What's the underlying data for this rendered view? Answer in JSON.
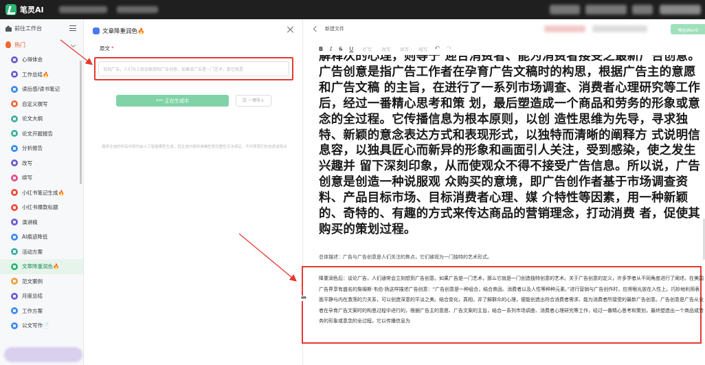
{
  "app": {
    "name": "笔灵AI",
    "brand_color": "#2bb673"
  },
  "sidebar": {
    "back_label": "前往工作台",
    "group_label": "热门",
    "items": [
      {
        "label": "心得体会",
        "color": "#6b5bd6"
      },
      {
        "label": "工作总结🔥",
        "color": "#6b5bd6"
      },
      {
        "label": "读后感/读书笔记",
        "color": "#3b8bf0"
      },
      {
        "label": "自定义撰写",
        "color": "#f06b3b"
      },
      {
        "label": "论文大纲",
        "color": "#3bb0a0"
      },
      {
        "label": "论文开题报告",
        "color": "#3bb0a0"
      },
      {
        "label": "分析报告",
        "color": "#3b8bf0"
      },
      {
        "label": "改写",
        "color": "#6b5bd6"
      },
      {
        "label": "续写",
        "color": "#e64a8c"
      },
      {
        "label": "小红书笔记生成🔥",
        "color": "#f04b3b"
      },
      {
        "label": "小红书爆款标题",
        "color": "#f04b3b"
      },
      {
        "label": "演讲稿",
        "color": "#6b5bd6"
      },
      {
        "label": "AI痕迹降低",
        "color": "#3b8bf0"
      },
      {
        "label": "活动方案",
        "color": "#3bb0a0"
      },
      {
        "label": "文章降重润色🔥",
        "color": "#2bb673",
        "active": true
      },
      {
        "label": "范文案例",
        "color": "#f0a03b"
      },
      {
        "label": "月度总结",
        "color": "#6b5bd6"
      },
      {
        "label": "工作方案",
        "color": "#3b8bf0"
      },
      {
        "label": "公文写作📄",
        "color": "#3b8bf0"
      }
    ]
  },
  "panel": {
    "title": "文章降重润色🔥",
    "source_label": "原文",
    "required_mark": "*",
    "source_placeholder": "说到广告，人们马上就会联想到广告创意。如果说广告是一门艺术，那它就是",
    "generate_button": "*** 正在生成中",
    "import_button": "🗐 一键导入",
    "disclaimer": "服务生成的所有内容均由人工智能模型生成，其生成内容的准确性和完整性无法保证，不代表我们的态度或观点"
  },
  "editor": {
    "doc_name": "新建文件",
    "save_label": "导出Word",
    "toolbar": {
      "bold": "B",
      "italic": "I",
      "strike": "S",
      "underline": "U",
      "expand": "扩写",
      "rewrite": "改写",
      "continue": "续写",
      "shorten": "缩写",
      "undo": "↶",
      "redo": "↷"
    },
    "body_large": "解释次的心理，则等于 迎合消费者、能为消费者接受之最新广告创意。 广告创意是指广告工作者在孕育广告文稿时的构思，根据广告主的意愿和广告文稿 的主旨，在进行了一系列市场调查、消费者心理研究等工作后，经过一番精心思考和策 划，最后塑造成一个商品和劳务的形象或意念的全过程。它传播信息为根本原则，以创 造性思维为先导，寻求独特、新颖的意念表达方式和表现形式，以独特而清晰的阐释方 式说明信息容，以独具匠心而新异的形象和画面引人关注，受到感染，使之发生兴趣并 留下深刻印象，从而使观众不得不接受广告信息。所以说，广告创意是创造一种说服观 众购买的意境，即广告创作者基于市场调查资料、产品目标市场、目标消费者心理、媒 介特性等因素，用一种新颖的、奇特的、有趣的方式来传达商品的营销理念，打动消费 者，促使其购买的策划过程。",
    "summary": "总体描述：广告与广告创意是人们关注的焦点，它们被视为一门独特的艺术形式。",
    "result": "降重润色后：谈论广告，人们通常会立刻想到广告创意。如果广告是一门艺术，那么它就是一门创造独特创意的艺术。关于广告创意的定义，许多学者从不同角度进行了阐述。在美国广告界享有盛名的詹姆斯·韦伯·扬这样描述广告创意：“广告创意是一种组合，结合商品、消费者以及人性等种种元素。”进行营销与广告创作时，应将眼光放在人性上。巧妙地利用表面平静与内在激荡的力关系，可以创造深意的平淡之美。结合变化，真相，并了解群众的心理，便能创造出符合消费者需求、能为消费者所接受的最新广告创意。广告创意是广告从业者在孕育广告文案时的构思过程中进行的，根据广告主的意愿、广告文案的主旨，结合一系列市场调查、消费者心理研究等工作，经过一番精心思考和策划，最终塑造出一个商品或劳务的形象或意念的全过程。它以传播信息为"
  },
  "colors": {
    "annotation_red": "#e5382e",
    "active_item_bg": "#e6f4ec",
    "generate_button": "#7fd3a7"
  }
}
